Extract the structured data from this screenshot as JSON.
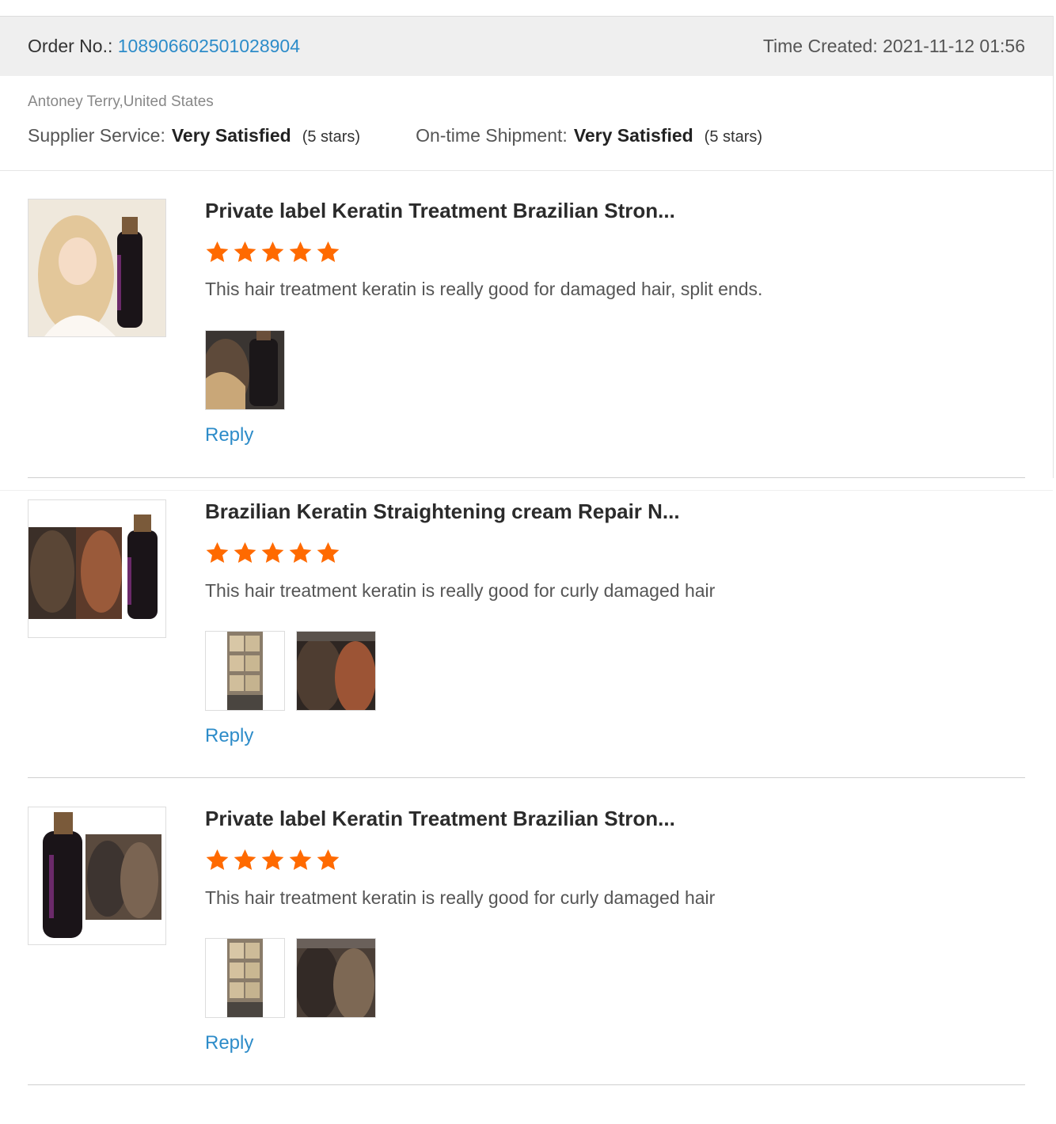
{
  "order": {
    "number_label": "Order No.: ",
    "number": "108906602501028904",
    "time_created": "Time Created: 2021-11-12 01:56"
  },
  "reviewer": "Antoney Terry,United States",
  "ratings": {
    "supplier_label": "Supplier Service:",
    "supplier_value": "Very Satisfied",
    "supplier_stars": "(5 stars)",
    "shipment_label": "On-time Shipment:",
    "shipment_value": "Very Satisfied",
    "shipment_stars": "(5 stars)"
  },
  "colors": {
    "accent_link": "#2d8cc9",
    "star": "#ff6a00"
  },
  "reviews": [
    {
      "title": "Private label Keratin Treatment Brazilian Stron...",
      "rating": 5,
      "text": "This hair treatment keratin is really good for damaged hair, split ends.",
      "photo_count": 1,
      "reply": "Reply"
    },
    {
      "title": "Brazilian Keratin Straightening cream Repair N...",
      "rating": 5,
      "text": "This hair treatment keratin is really good for curly damaged hair",
      "photo_count": 2,
      "reply": "Reply"
    },
    {
      "title": "Private label Keratin Treatment Brazilian Stron...",
      "rating": 5,
      "text": "This hair treatment keratin is really good for curly damaged hair",
      "photo_count": 2,
      "reply": "Reply"
    }
  ]
}
